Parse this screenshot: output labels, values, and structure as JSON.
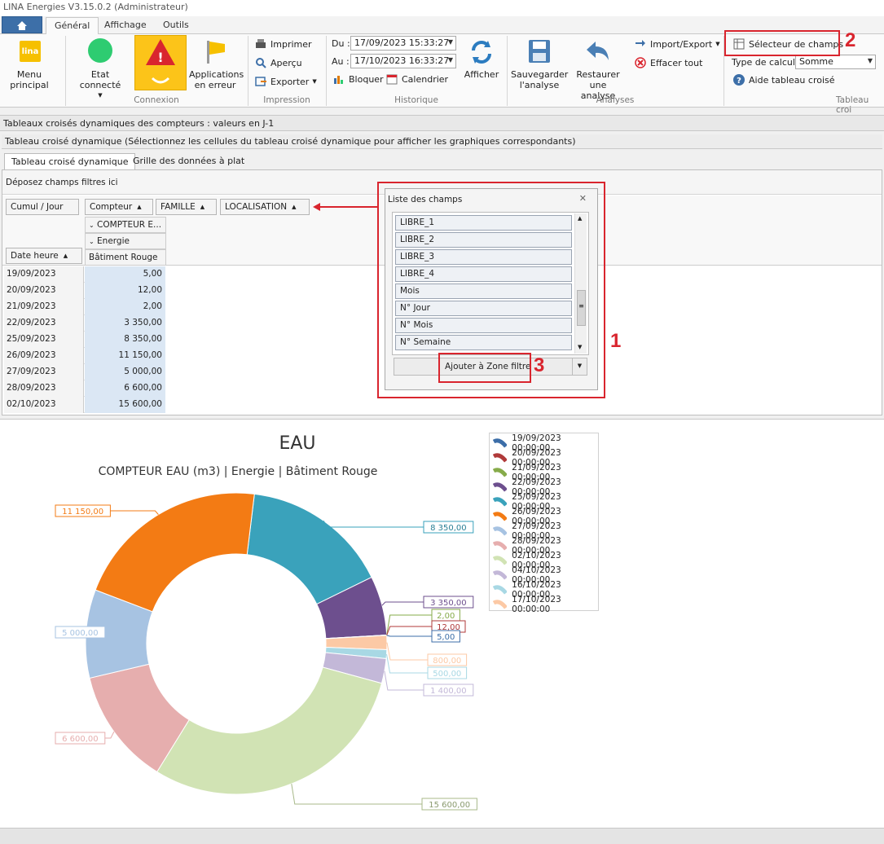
{
  "window": {
    "title": "LINA Energies  V3.15.0.2  (Administrateur)"
  },
  "ribbon": {
    "tabs": [
      "Général",
      "Affichage",
      "Outils"
    ],
    "menu_principal": "Menu principal",
    "etat_connecte": "Etat connecté",
    "applications_en_erreur": "Applications en erreur",
    "grp_connexion": "Connexion",
    "imprimer": "Imprimer",
    "apercu": "Aperçu",
    "exporter": "Exporter",
    "grp_impression": "Impression",
    "du_label": "Du :",
    "du_value": "17/09/2023 15:33:27",
    "au_label": "Au :",
    "au_value": "17/10/2023 16:33:27",
    "bloquer": "Bloquer",
    "calendrier": "Calendrier",
    "grp_historique": "Historique",
    "afficher": "Afficher",
    "sauvegarder": "Sauvegarder l'analyse",
    "restaurer": "Restaurer une analyse",
    "import_export": "Import/Export",
    "effacer_tout": "Effacer tout",
    "grp_analyses": "Analyses",
    "selecteur_champs": "Sélecteur de champs",
    "type_calcul_label": "Type de calcul :",
    "type_calcul_value": "Somme",
    "aide_tableau": "Aide tableau croisé",
    "grp_tableau": "Tableau croi"
  },
  "panel": {
    "title": "Tableaux croisés dynamiques des compteurs : valeurs en J-1",
    "subtitle": "Tableau croisé dynamique (Sélectionnez les cellules du tableau croisé dynamique pour afficher les graphiques correspondants)",
    "tabs": [
      "Tableau croisé dynamique",
      "Grille des données à plat"
    ]
  },
  "pivot": {
    "filter_zone": "Déposez champs filtres ici",
    "data_field": "Cumul / Jour",
    "column_fields": [
      "Compteur",
      "FAMILLE",
      "LOCALISATION"
    ],
    "row_field": "Date heure",
    "col_header_1": "COMPTEUR E...",
    "col_header_2": "Energie",
    "col_header_3": "Bâtiment Rouge",
    "rows": [
      {
        "date": "19/09/2023",
        "value": "5,00"
      },
      {
        "date": "20/09/2023",
        "value": "12,00"
      },
      {
        "date": "21/09/2023",
        "value": "2,00"
      },
      {
        "date": "22/09/2023",
        "value": "3 350,00"
      },
      {
        "date": "25/09/2023",
        "value": "8 350,00"
      },
      {
        "date": "26/09/2023",
        "value": "11 150,00"
      },
      {
        "date": "27/09/2023",
        "value": "5 000,00"
      },
      {
        "date": "28/09/2023",
        "value": "6 600,00"
      },
      {
        "date": "02/10/2023",
        "value": "15 600,00"
      }
    ]
  },
  "field_list": {
    "title": "Liste des champs",
    "items": [
      "LIBRE_1",
      "LIBRE_2",
      "LIBRE_3",
      "LIBRE_4",
      "Mois",
      "N° Jour",
      "N° Mois",
      "N° Semaine"
    ],
    "add_button": "Ajouter à Zone filtre"
  },
  "callouts": {
    "one": "1",
    "two": "2",
    "three": "3"
  },
  "chart_data": {
    "type": "pie",
    "donut": true,
    "title": "EAU",
    "subtitle": "COMPTEUR EAU (m3) | Energie | Bâtiment Rouge",
    "categories": [
      "19/09/2023 00:00:00",
      "20/09/2023 00:00:00",
      "21/09/2023 00:00:00",
      "22/09/2023 00:00:00",
      "25/09/2023 00:00:00",
      "26/09/2023 00:00:00",
      "27/09/2023 00:00:00",
      "28/09/2023 00:00:00",
      "02/10/2023 00:00:00",
      "04/10/2023 00:00:00",
      "16/10/2023 00:00:00",
      "17/10/2023 00:00:00"
    ],
    "values": [
      5,
      12,
      2,
      3350,
      8350,
      11150,
      5000,
      6600,
      15600,
      1400,
      500,
      800
    ],
    "labels": [
      "5,00",
      "12,00",
      "2,00",
      "3 350,00",
      "8 350,00",
      "11 150,00",
      "5 000,00",
      "6 600,00",
      "15 600,00",
      "1 400,00",
      "500,00",
      "800,00"
    ],
    "colors": [
      "#3c6ea8",
      "#b03a3a",
      "#86ab4a",
      "#6d4f8e",
      "#3aa2bb",
      "#f37b14",
      "#a7c3e2",
      "#e6aeae",
      "#d1e3b4",
      "#c3b8d8",
      "#a8d8e4",
      "#fcc9a5"
    ],
    "legend_position": "right"
  }
}
